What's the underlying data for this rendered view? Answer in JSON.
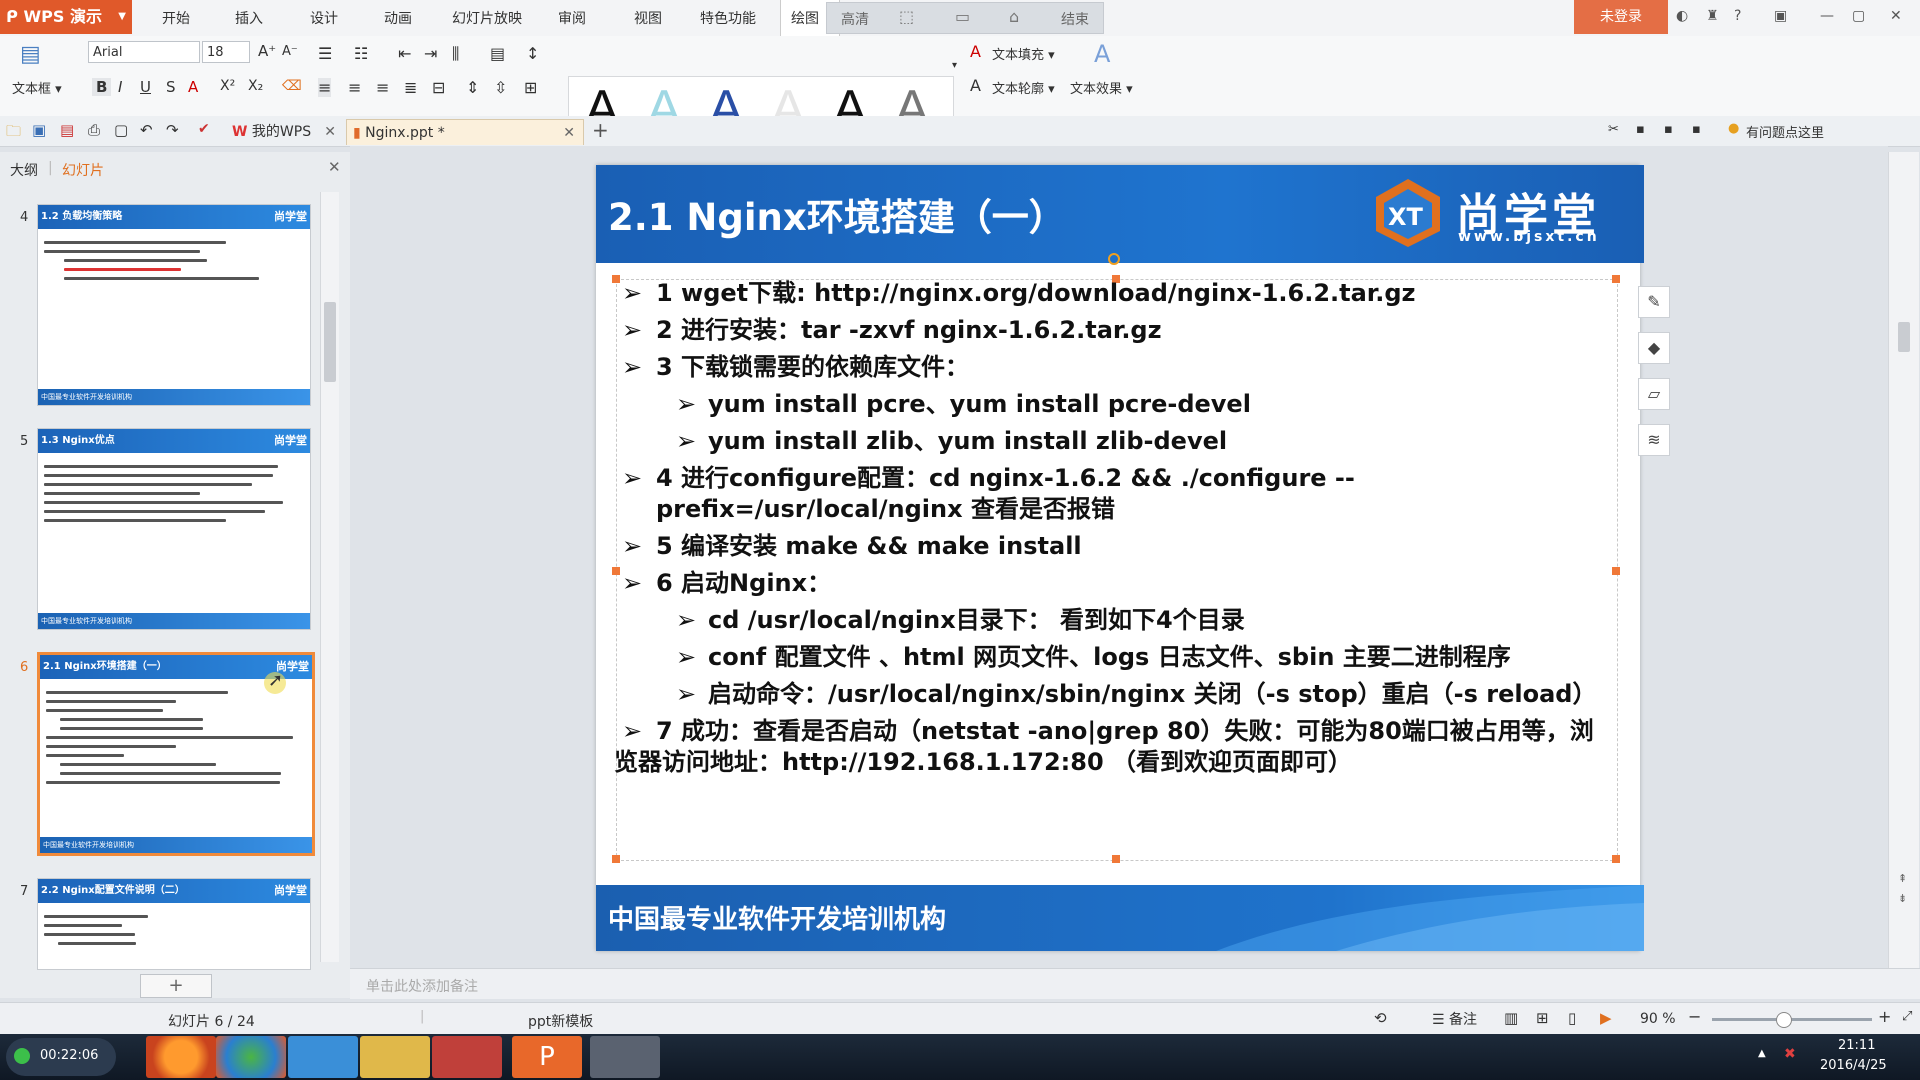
{
  "app": {
    "name": "WPS 演示",
    "login": "未登录",
    "help_tip": "有问题点这里"
  },
  "menu": {
    "tabs": [
      "开始",
      "插入",
      "设计",
      "动画",
      "幻灯片放映",
      "审阅",
      "视图",
      "特色功能",
      "绘图工具"
    ],
    "quick": [
      "高清",
      "结束"
    ]
  },
  "ribbon": {
    "textbox_label": "文本框",
    "font_name": "Arial",
    "font_size": "18",
    "text_fill": "文本填充",
    "text_outline": "文本轮廓",
    "text_effect": "文本效果",
    "style_glyph": "A"
  },
  "doctabs": {
    "home": "我的WPS",
    "current": "Nginx.ppt *"
  },
  "leftpanel": {
    "tab_outline": "大纲",
    "tab_slides": "幻灯片",
    "add": "+",
    "thumbs": [
      {
        "num": "4",
        "title": "1.2 负载均衡策略"
      },
      {
        "num": "5",
        "title": "1.3 Nginx优点"
      },
      {
        "num": "6",
        "title": "2.1 Nginx环境搭建（一）"
      },
      {
        "num": "7",
        "title": "2.2 Nginx配置文件说明（二）"
      }
    ],
    "thumb_footer": "中国最专业软件开发培训机构",
    "thumb_logo": "尚学堂"
  },
  "slide": {
    "title": "2.1 Nginx环境搭建（一）",
    "logo_cn": "尚学堂",
    "logo_url": "www.bjsxt.cn",
    "footer": "中国最专业软件开发培训机构",
    "marker": "➢",
    "bullets": [
      "1 wget下载: http://nginx.org/download/nginx-1.6.2.tar.gz",
      "2 进行安装：tar -zxvf nginx-1.6.2.tar.gz",
      "3 下载锁需要的依赖库文件：",
      "yum install pcre、yum install pcre-devel",
      "yum install zlib、yum install zlib-devel",
      "4 进行configure配置：cd nginx-1.6.2 && ./configure --prefix=/usr/local/nginx 查看是否报错",
      "5 编译安装 make && make install",
      "6 启动Nginx：",
      "cd /usr/local/nginx目录下： 看到如下4个目录",
      "conf 配置文件 、html 网页文件、logs  日志文件、sbin  主要二进制程序",
      "启动命令：/usr/local/nginx/sbin/nginx 关闭（-s stop）重启（-s reload）",
      "7 成功：查看是否启动（netstat -ano|grep 80）失败：可能为80端口被占用等，浏览器访问地址：http://192.168.1.172:80 （看到欢迎页面即可）"
    ]
  },
  "notes": {
    "placeholder": "单击此处添加备注"
  },
  "status": {
    "slide_pos": "幻灯片 6 / 24",
    "template": "ppt新模板",
    "notes": "备注",
    "zoom": "90 %"
  },
  "taskbar": {
    "timer": "00:22:06",
    "time": "21:11",
    "date": "2016/4/25"
  },
  "colors": {
    "wps_orange": "#e0592a",
    "slide_blue": "#1f6fc8",
    "selection": "#f08a3a"
  }
}
